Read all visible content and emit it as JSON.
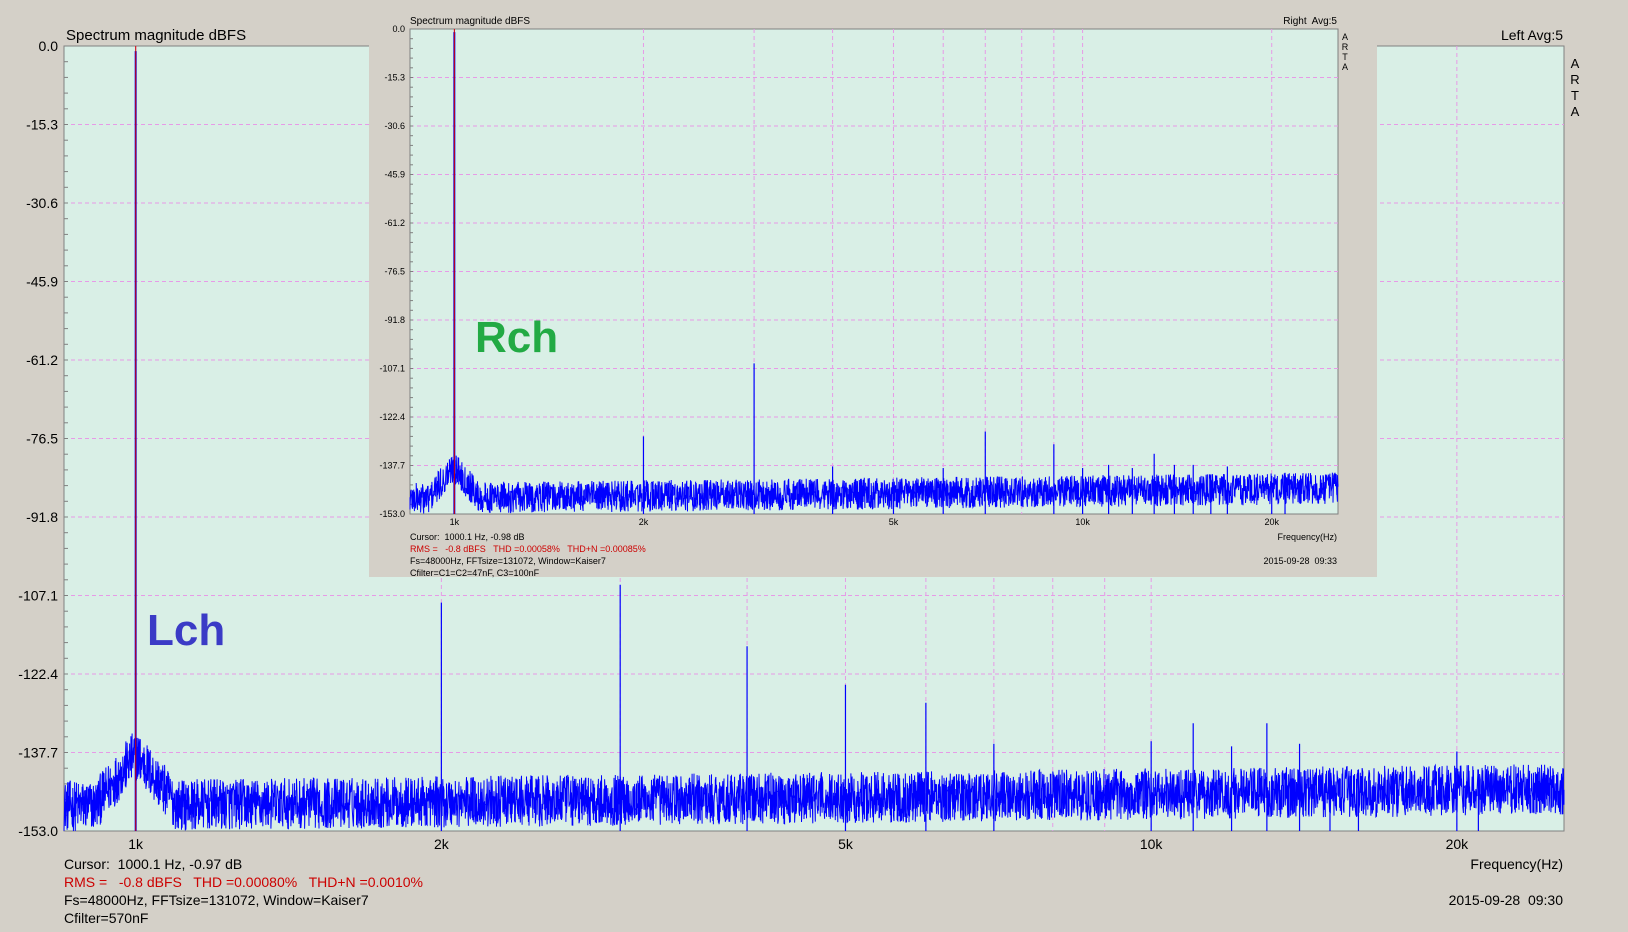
{
  "colors": {
    "window_bg": "#d4d0c8",
    "plot_bg": "#d9efe6",
    "grid": "#e79ae7",
    "trace": "#0000ff",
    "cursor": "#cc0000",
    "rms_text": "#cc0000",
    "label_text": "#000000",
    "lch_label": "#3b3bc6",
    "rch_label": "#22aa44"
  },
  "chart_data": [
    {
      "type": "line",
      "panel": "main",
      "channel_label": "Lch",
      "title": "Spectrum magnitude dBFS",
      "channel_info": "Left  Avg:5",
      "brand": "ARTA",
      "xlabel": "Frequency(Hz)",
      "x_scale": "log",
      "xlim": [
        850,
        25500
      ],
      "x_ticks": [
        {
          "value": 1000,
          "label": "1k"
        },
        {
          "value": 2000,
          "label": "2k"
        },
        {
          "value": 5000,
          "label": "5k"
        },
        {
          "value": 10000,
          "label": "10k"
        },
        {
          "value": 20000,
          "label": "20k"
        }
      ],
      "ylim": [
        -153.0,
        0.0
      ],
      "y_ticks": [
        "0.0",
        "-15.3",
        "-30.6",
        "-45.9",
        "-61.2",
        "-76.5",
        "-91.8",
        "-107.1",
        "-122.4",
        "-137.7",
        "-153.0"
      ],
      "cursor_hz": 1000.1,
      "fundamental_db": -0.97,
      "noise_floor_db": -148,
      "peaks": [
        {
          "x": 1000,
          "y": -1.0
        },
        {
          "x": 2000,
          "y": -108.5
        },
        {
          "x": 3000,
          "y": -105.0
        },
        {
          "x": 4000,
          "y": -117.0
        },
        {
          "x": 5000,
          "y": -124.5
        },
        {
          "x": 6000,
          "y": -128.0
        },
        {
          "x": 7000,
          "y": -136.0
        },
        {
          "x": 10000,
          "y": -135.5
        },
        {
          "x": 11000,
          "y": -132.0
        },
        {
          "x": 12000,
          "y": -136.5
        },
        {
          "x": 13000,
          "y": -132.0
        },
        {
          "x": 14000,
          "y": -136.0
        },
        {
          "x": 15000,
          "y": -141.0
        },
        {
          "x": 16000,
          "y": -141.0
        },
        {
          "x": 20000,
          "y": -137.5
        },
        {
          "x": 21000,
          "y": -141.0
        }
      ],
      "info": {
        "cursor": "Cursor:  1000.1 Hz, -0.97 dB",
        "rms": "RMS =   -0.8 dBFS   THD =0.00080%   THD+N =0.0010%",
        "fs": "Fs=48000Hz, FFTsize=131072, Window=Kaiser7",
        "cfilter": "Cfilter=570nF",
        "timestamp": "2015-09-28  09:30"
      }
    },
    {
      "type": "line",
      "panel": "inset",
      "channel_label": "Rch",
      "title": "Spectrum magnitude dBFS",
      "channel_info": "Right  Avg:5",
      "brand": "ARTA",
      "xlabel": "Frequency(Hz)",
      "x_scale": "log",
      "xlim": [
        850,
        25500
      ],
      "x_ticks": [
        {
          "value": 1000,
          "label": "1k"
        },
        {
          "value": 2000,
          "label": "2k"
        },
        {
          "value": 5000,
          "label": "5k"
        },
        {
          "value": 10000,
          "label": "10k"
        },
        {
          "value": 20000,
          "label": "20k"
        }
      ],
      "ylim": [
        -153.0,
        0.0
      ],
      "y_ticks": [
        "0.0",
        "-15.3",
        "-30.6",
        "-45.9",
        "-61.2",
        "-76.5",
        "-91.8",
        "-107.1",
        "-122.4",
        "-137.7",
        "-153.0"
      ],
      "cursor_hz": 1000.1,
      "fundamental_db": -0.98,
      "noise_floor_db": -148,
      "peaks": [
        {
          "x": 1000,
          "y": -1.0
        },
        {
          "x": 2000,
          "y": -128.5
        },
        {
          "x": 3000,
          "y": -105.5
        },
        {
          "x": 4000,
          "y": -138.0
        },
        {
          "x": 5000,
          "y": -147.0
        },
        {
          "x": 6000,
          "y": -138.5
        },
        {
          "x": 7000,
          "y": -127.0
        },
        {
          "x": 9000,
          "y": -131.0
        },
        {
          "x": 10000,
          "y": -138.5
        },
        {
          "x": 11000,
          "y": -137.5
        },
        {
          "x": 12000,
          "y": -138.5
        },
        {
          "x": 13000,
          "y": -134.0
        },
        {
          "x": 14000,
          "y": -137.5
        },
        {
          "x": 15000,
          "y": -137.5
        },
        {
          "x": 16000,
          "y": -140.5
        },
        {
          "x": 17000,
          "y": -138.0
        },
        {
          "x": 20000,
          "y": -141.0
        },
        {
          "x": 21000,
          "y": -140.0
        }
      ],
      "info": {
        "cursor": "Cursor:  1000.1 Hz, -0.98 dB",
        "rms": "RMS =   -0.8 dBFS   THD =0.00058%   THD+N =0.00085%",
        "fs": "Fs=48000Hz, FFTsize=131072, Window=Kaiser7",
        "cfilter": "Cfilter=C1=C2=47nF, C3=100nF",
        "timestamp": "2015-09-28  09:33"
      }
    }
  ]
}
